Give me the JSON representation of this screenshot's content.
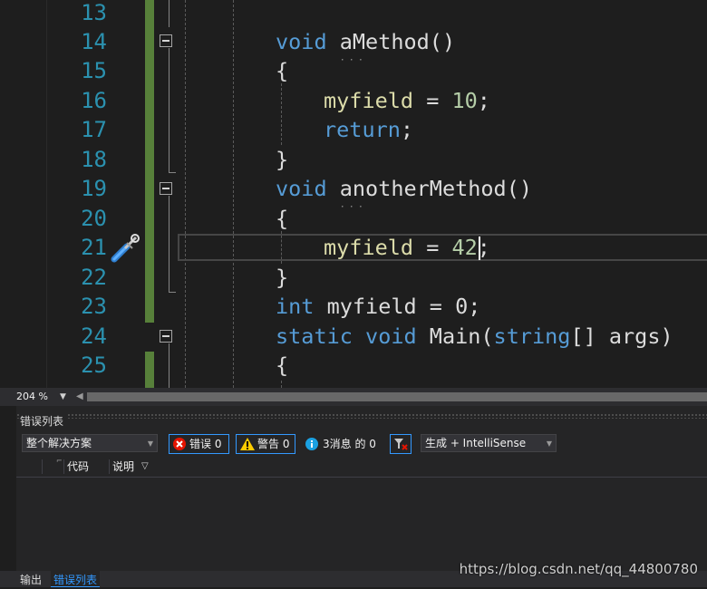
{
  "editor": {
    "line_numbers": [
      "13",
      "14",
      "15",
      "16",
      "17",
      "18",
      "19",
      "20",
      "21",
      "22",
      "23",
      "24",
      "25"
    ],
    "code": {
      "l14": {
        "kw": "void",
        "name_first": "a",
        "name_rest": "Method",
        "parens": "()"
      },
      "l15": {
        "text": "{"
      },
      "l16": {
        "field": "myfield",
        "op": " = ",
        "num": "10",
        "semi": ";"
      },
      "l17": {
        "kw": "return",
        "semi": ";"
      },
      "l18": {
        "text": "}"
      },
      "l19": {
        "kw": "void",
        "name_first": "a",
        "name_rest": "notherMethod",
        "parens": "()"
      },
      "l20": {
        "text": "{"
      },
      "l21": {
        "field": "myfield",
        "op": " = ",
        "num": "42",
        "semi": ";"
      },
      "l22": {
        "text": "}"
      },
      "l23": {
        "kw": "int",
        "rest": " myfield = 0;"
      },
      "l24": {
        "kw1": "static",
        "kw2": "void",
        "name": "Main",
        "open": "(",
        "type": "string",
        "rest": "[] args)"
      },
      "l25": {
        "text": "{"
      }
    },
    "colors": {
      "keyword": "#569cd6",
      "field": "#dcdcaa",
      "number": "#b5cea8",
      "line_number": "#2b91af",
      "change_bar": "#57803a"
    },
    "icons": {
      "quick_action": "screwdriver-wrench-icon"
    }
  },
  "status_bar": {
    "zoom": "204 %"
  },
  "error_list": {
    "title": "错误列表",
    "scope": "整个解决方案",
    "errors_label": "错误 0",
    "warnings_label": "警告 0",
    "messages_label": "3消息 的 0",
    "build_filter": "生成 + IntelliSense",
    "columns": {
      "code": "代码",
      "description": "说明"
    }
  },
  "bottom_tabs": {
    "output": "输出",
    "error_list": "错误列表"
  },
  "watermark": "https://blog.csdn.net/qq_44800780"
}
